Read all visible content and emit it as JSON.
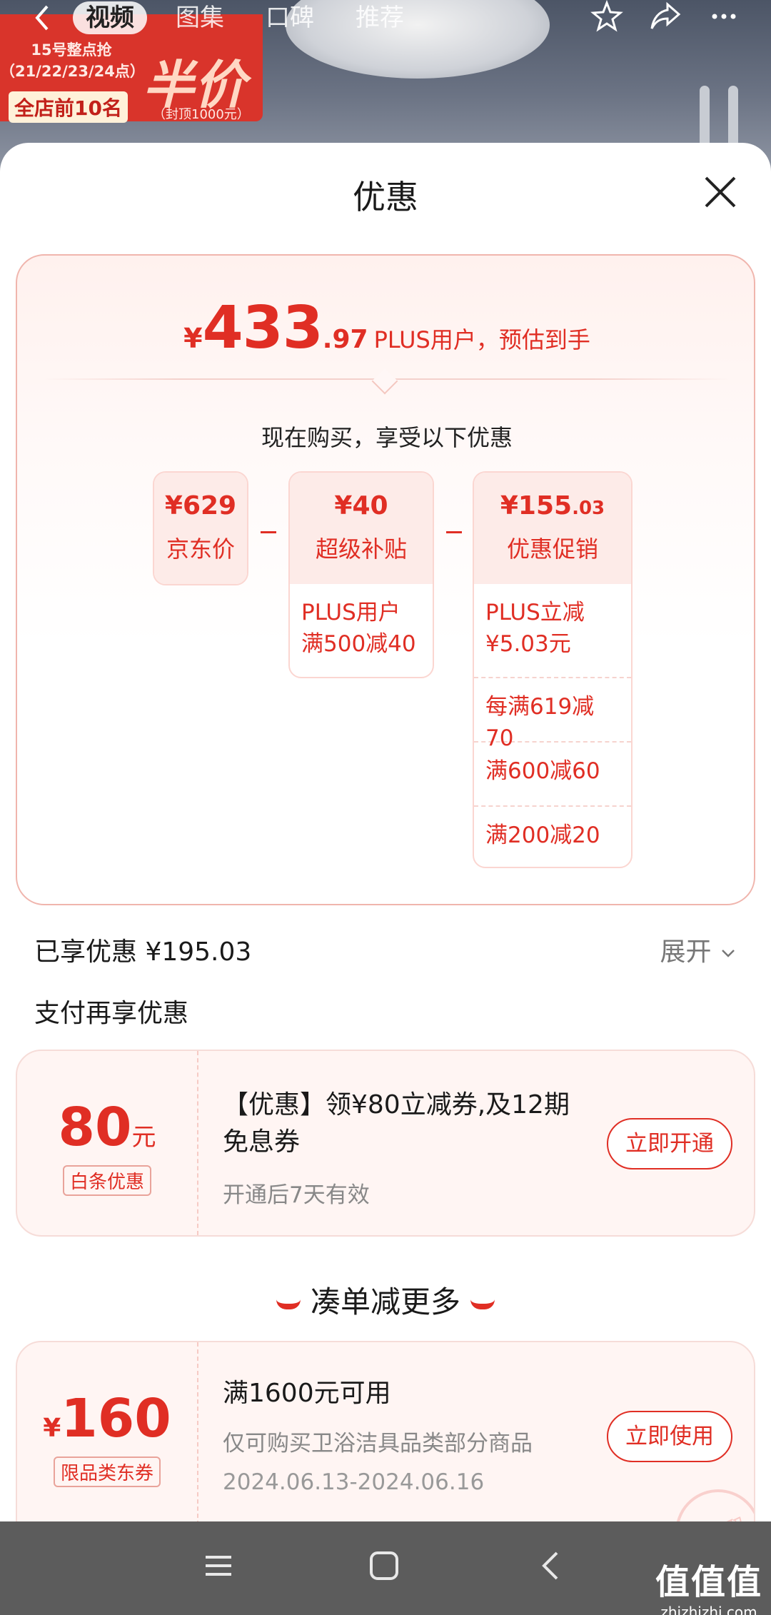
{
  "background": {
    "promo_line1": "15号整点抢",
    "promo_line2": "（21/22/23/24点）",
    "promo_rank": "全店前10名",
    "promo_big": "半价",
    "promo_cap": "（封顶1000元）",
    "nav_tabs": [
      "视频",
      "图集",
      "口碑",
      "推荐"
    ],
    "active_tab": "视频"
  },
  "sheet": {
    "title": "优惠"
  },
  "estimate": {
    "yen": "¥",
    "int": "433",
    "dec": ".97",
    "label": "PLUS用户，预估到手"
  },
  "now_buy": "现在购买，享受以下优惠",
  "columns": {
    "jd_price": {
      "amount": "¥629",
      "label": "京东价"
    },
    "subsidy": {
      "amount": "¥40",
      "label": "超级补贴",
      "items": [
        "PLUS用户\n满500减40"
      ]
    },
    "promo": {
      "amount_main": "¥155",
      "amount_dec": ".03",
      "label": "优惠促销",
      "items": [
        "PLUS立减\n¥5.03元",
        "每满619减70",
        "满600减60",
        "满200减20"
      ]
    }
  },
  "saved": {
    "text": "已享优惠 ¥195.03",
    "expand": "展开"
  },
  "pay_section_title": "支付再享优惠",
  "baitiao_coupon": {
    "amount": "80",
    "unit": "元",
    "tag": "白条优惠",
    "title": "【优惠】领¥80立减券,及12期免息券",
    "subtitle": "开通后7天有效",
    "button": "立即开通"
  },
  "more_title": "凑单减更多",
  "category_coupon": {
    "yen": "¥",
    "amount": "160",
    "tag": "限品类东券",
    "title": "满1600元可用",
    "subtitle": "仅可购买卫浴洁具品类部分商品",
    "date": "2024.06.13-2024.06.16",
    "button": "立即使用",
    "stamp": "已领取"
  },
  "watermark": {
    "big": "值值值",
    "small": "zhizhizhi.com"
  },
  "colors": {
    "accent": "#e02e24",
    "nav_bar": "#5c5c5c"
  }
}
